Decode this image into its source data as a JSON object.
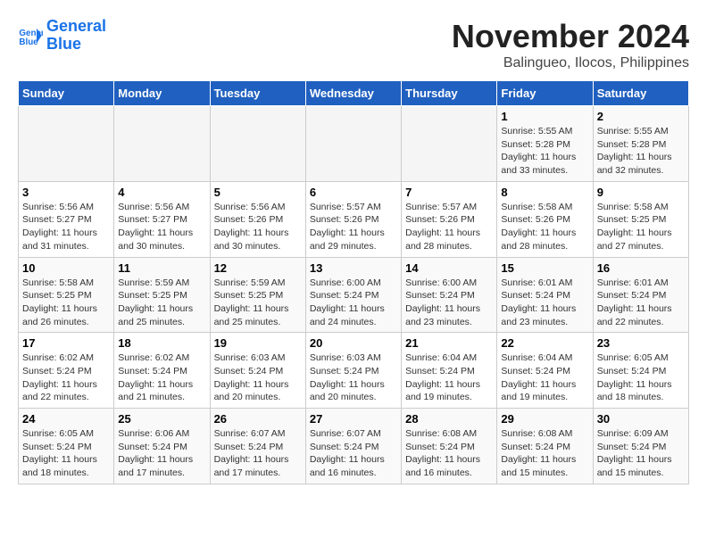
{
  "header": {
    "logo_line1": "General",
    "logo_line2": "Blue",
    "month": "November 2024",
    "location": "Balingueo, Ilocos, Philippines"
  },
  "weekdays": [
    "Sunday",
    "Monday",
    "Tuesday",
    "Wednesday",
    "Thursday",
    "Friday",
    "Saturday"
  ],
  "weeks": [
    [
      {
        "day": "",
        "info": ""
      },
      {
        "day": "",
        "info": ""
      },
      {
        "day": "",
        "info": ""
      },
      {
        "day": "",
        "info": ""
      },
      {
        "day": "",
        "info": ""
      },
      {
        "day": "1",
        "info": "Sunrise: 5:55 AM\nSunset: 5:28 PM\nDaylight: 11 hours\nand 33 minutes."
      },
      {
        "day": "2",
        "info": "Sunrise: 5:55 AM\nSunset: 5:28 PM\nDaylight: 11 hours\nand 32 minutes."
      }
    ],
    [
      {
        "day": "3",
        "info": "Sunrise: 5:56 AM\nSunset: 5:27 PM\nDaylight: 11 hours\nand 31 minutes."
      },
      {
        "day": "4",
        "info": "Sunrise: 5:56 AM\nSunset: 5:27 PM\nDaylight: 11 hours\nand 30 minutes."
      },
      {
        "day": "5",
        "info": "Sunrise: 5:56 AM\nSunset: 5:26 PM\nDaylight: 11 hours\nand 30 minutes."
      },
      {
        "day": "6",
        "info": "Sunrise: 5:57 AM\nSunset: 5:26 PM\nDaylight: 11 hours\nand 29 minutes."
      },
      {
        "day": "7",
        "info": "Sunrise: 5:57 AM\nSunset: 5:26 PM\nDaylight: 11 hours\nand 28 minutes."
      },
      {
        "day": "8",
        "info": "Sunrise: 5:58 AM\nSunset: 5:26 PM\nDaylight: 11 hours\nand 28 minutes."
      },
      {
        "day": "9",
        "info": "Sunrise: 5:58 AM\nSunset: 5:25 PM\nDaylight: 11 hours\nand 27 minutes."
      }
    ],
    [
      {
        "day": "10",
        "info": "Sunrise: 5:58 AM\nSunset: 5:25 PM\nDaylight: 11 hours\nand 26 minutes."
      },
      {
        "day": "11",
        "info": "Sunrise: 5:59 AM\nSunset: 5:25 PM\nDaylight: 11 hours\nand 25 minutes."
      },
      {
        "day": "12",
        "info": "Sunrise: 5:59 AM\nSunset: 5:25 PM\nDaylight: 11 hours\nand 25 minutes."
      },
      {
        "day": "13",
        "info": "Sunrise: 6:00 AM\nSunset: 5:24 PM\nDaylight: 11 hours\nand 24 minutes."
      },
      {
        "day": "14",
        "info": "Sunrise: 6:00 AM\nSunset: 5:24 PM\nDaylight: 11 hours\nand 23 minutes."
      },
      {
        "day": "15",
        "info": "Sunrise: 6:01 AM\nSunset: 5:24 PM\nDaylight: 11 hours\nand 23 minutes."
      },
      {
        "day": "16",
        "info": "Sunrise: 6:01 AM\nSunset: 5:24 PM\nDaylight: 11 hours\nand 22 minutes."
      }
    ],
    [
      {
        "day": "17",
        "info": "Sunrise: 6:02 AM\nSunset: 5:24 PM\nDaylight: 11 hours\nand 22 minutes."
      },
      {
        "day": "18",
        "info": "Sunrise: 6:02 AM\nSunset: 5:24 PM\nDaylight: 11 hours\nand 21 minutes."
      },
      {
        "day": "19",
        "info": "Sunrise: 6:03 AM\nSunset: 5:24 PM\nDaylight: 11 hours\nand 20 minutes."
      },
      {
        "day": "20",
        "info": "Sunrise: 6:03 AM\nSunset: 5:24 PM\nDaylight: 11 hours\nand 20 minutes."
      },
      {
        "day": "21",
        "info": "Sunrise: 6:04 AM\nSunset: 5:24 PM\nDaylight: 11 hours\nand 19 minutes."
      },
      {
        "day": "22",
        "info": "Sunrise: 6:04 AM\nSunset: 5:24 PM\nDaylight: 11 hours\nand 19 minutes."
      },
      {
        "day": "23",
        "info": "Sunrise: 6:05 AM\nSunset: 5:24 PM\nDaylight: 11 hours\nand 18 minutes."
      }
    ],
    [
      {
        "day": "24",
        "info": "Sunrise: 6:05 AM\nSunset: 5:24 PM\nDaylight: 11 hours\nand 18 minutes."
      },
      {
        "day": "25",
        "info": "Sunrise: 6:06 AM\nSunset: 5:24 PM\nDaylight: 11 hours\nand 17 minutes."
      },
      {
        "day": "26",
        "info": "Sunrise: 6:07 AM\nSunset: 5:24 PM\nDaylight: 11 hours\nand 17 minutes."
      },
      {
        "day": "27",
        "info": "Sunrise: 6:07 AM\nSunset: 5:24 PM\nDaylight: 11 hours\nand 16 minutes."
      },
      {
        "day": "28",
        "info": "Sunrise: 6:08 AM\nSunset: 5:24 PM\nDaylight: 11 hours\nand 16 minutes."
      },
      {
        "day": "29",
        "info": "Sunrise: 6:08 AM\nSunset: 5:24 PM\nDaylight: 11 hours\nand 15 minutes."
      },
      {
        "day": "30",
        "info": "Sunrise: 6:09 AM\nSunset: 5:24 PM\nDaylight: 11 hours\nand 15 minutes."
      }
    ]
  ]
}
